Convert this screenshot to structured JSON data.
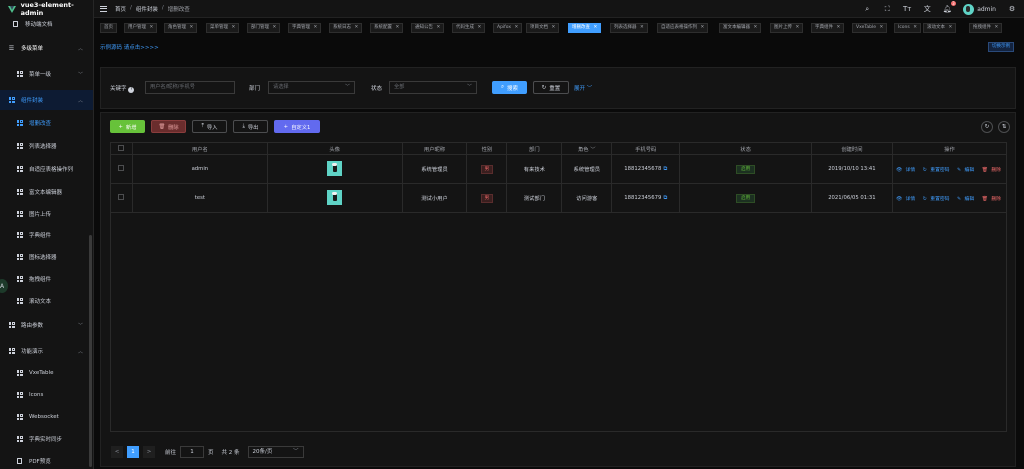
{
  "app": {
    "title": "vue3-element-admin"
  },
  "sidebar": {
    "items": [
      {
        "label": "移动端文档",
        "icon": "document-icon"
      },
      {
        "label": "多级菜单",
        "icon": "menu-icon"
      },
      {
        "label": "菜单一级",
        "icon": "grid-icon"
      },
      {
        "label": "组件封装",
        "icon": "grid-icon"
      },
      {
        "label": "增删改查",
        "icon": "grid-icon"
      },
      {
        "label": "列表选择器",
        "icon": "grid-icon"
      },
      {
        "label": "自适应表格操作列",
        "icon": "grid-icon"
      },
      {
        "label": "富文本编辑器",
        "icon": "grid-icon"
      },
      {
        "label": "图片上传",
        "icon": "grid-icon"
      },
      {
        "label": "字典组件",
        "icon": "grid-icon"
      },
      {
        "label": "图标选择器",
        "icon": "grid-icon"
      },
      {
        "label": "拖拽组件",
        "icon": "grid-icon"
      },
      {
        "label": "滚动文本",
        "icon": "grid-icon"
      },
      {
        "label": "路由参数",
        "icon": "grid-icon"
      },
      {
        "label": "功能演示",
        "icon": "grid-icon"
      },
      {
        "label": "VxeTable",
        "icon": "grid-icon"
      },
      {
        "label": "Icons",
        "icon": "grid-icon"
      },
      {
        "label": "Websocket",
        "icon": "grid-icon"
      },
      {
        "label": "字典实时同步",
        "icon": "grid-icon"
      },
      {
        "label": "PDF预览",
        "icon": "document-icon"
      }
    ],
    "avatar_letter": "A"
  },
  "header": {
    "breadcrumb": [
      "首页",
      "组件封装",
      "增删改查"
    ],
    "user_name": "admin",
    "notification_count": "3"
  },
  "tags": [
    "首页",
    "用户管理",
    "角色管理",
    "菜单管理",
    "部门管理",
    "字典管理",
    "系统日志",
    "系统配置",
    "通知公告",
    "代码生成",
    "Apifox",
    "项目文档",
    "增删改查",
    "列表选择器",
    "自适应表格操作列",
    "富文本编辑器",
    "图片上传",
    "字典组件",
    "VxeTable",
    "Icons",
    "滚动文本",
    "拖拽组件"
  ],
  "active_tag": "增删改查",
  "example_link": "示例源码 请点击>>>>",
  "switch_example": "切换示例",
  "search": {
    "keyword_label": "关键字",
    "keyword_placeholder": "用户名/昵称/手机号",
    "dept_label": "部门",
    "dept_placeholder": "请选择",
    "status_label": "状态",
    "status_placeholder": "全部",
    "search_button": "搜索",
    "reset_button": "重置",
    "expand": "展开"
  },
  "toolbar": {
    "add": "新增",
    "delete": "删除",
    "import": "导入",
    "export": "导出",
    "custom": "自定义1"
  },
  "table": {
    "columns": [
      "用户名",
      "头像",
      "用户昵称",
      "性别",
      "部门",
      "角色",
      "手机号码",
      "状态",
      "创建时间",
      "操作"
    ],
    "rows": [
      {
        "username": "admin",
        "nickname": "系统管理员",
        "gender": "男",
        "dept": "有来技术",
        "role": "系统管理员",
        "phone": "18812345678",
        "status": "启用",
        "created": "2019/10/10 13:41"
      },
      {
        "username": "test",
        "nickname": "测试小用户",
        "gender": "男",
        "dept": "测试部门",
        "role": "访问游客",
        "phone": "18812345679",
        "status": "启用",
        "created": "2021/06/05 01:31"
      }
    ],
    "actions": {
      "detail": "详情",
      "reset_pwd": "重置密码",
      "edit": "编辑",
      "delete": "删除"
    }
  },
  "pagination": {
    "prev": "<",
    "next": ">",
    "current_page": "1",
    "goto_label": "前往",
    "goto_value": "1",
    "page_suffix": "页",
    "total": "共 2 条",
    "page_size": "20条/页"
  },
  "colors": {
    "primary": "#409eff",
    "success": "#67c23a",
    "danger": "#f56c6c",
    "custom": "#626aef"
  }
}
